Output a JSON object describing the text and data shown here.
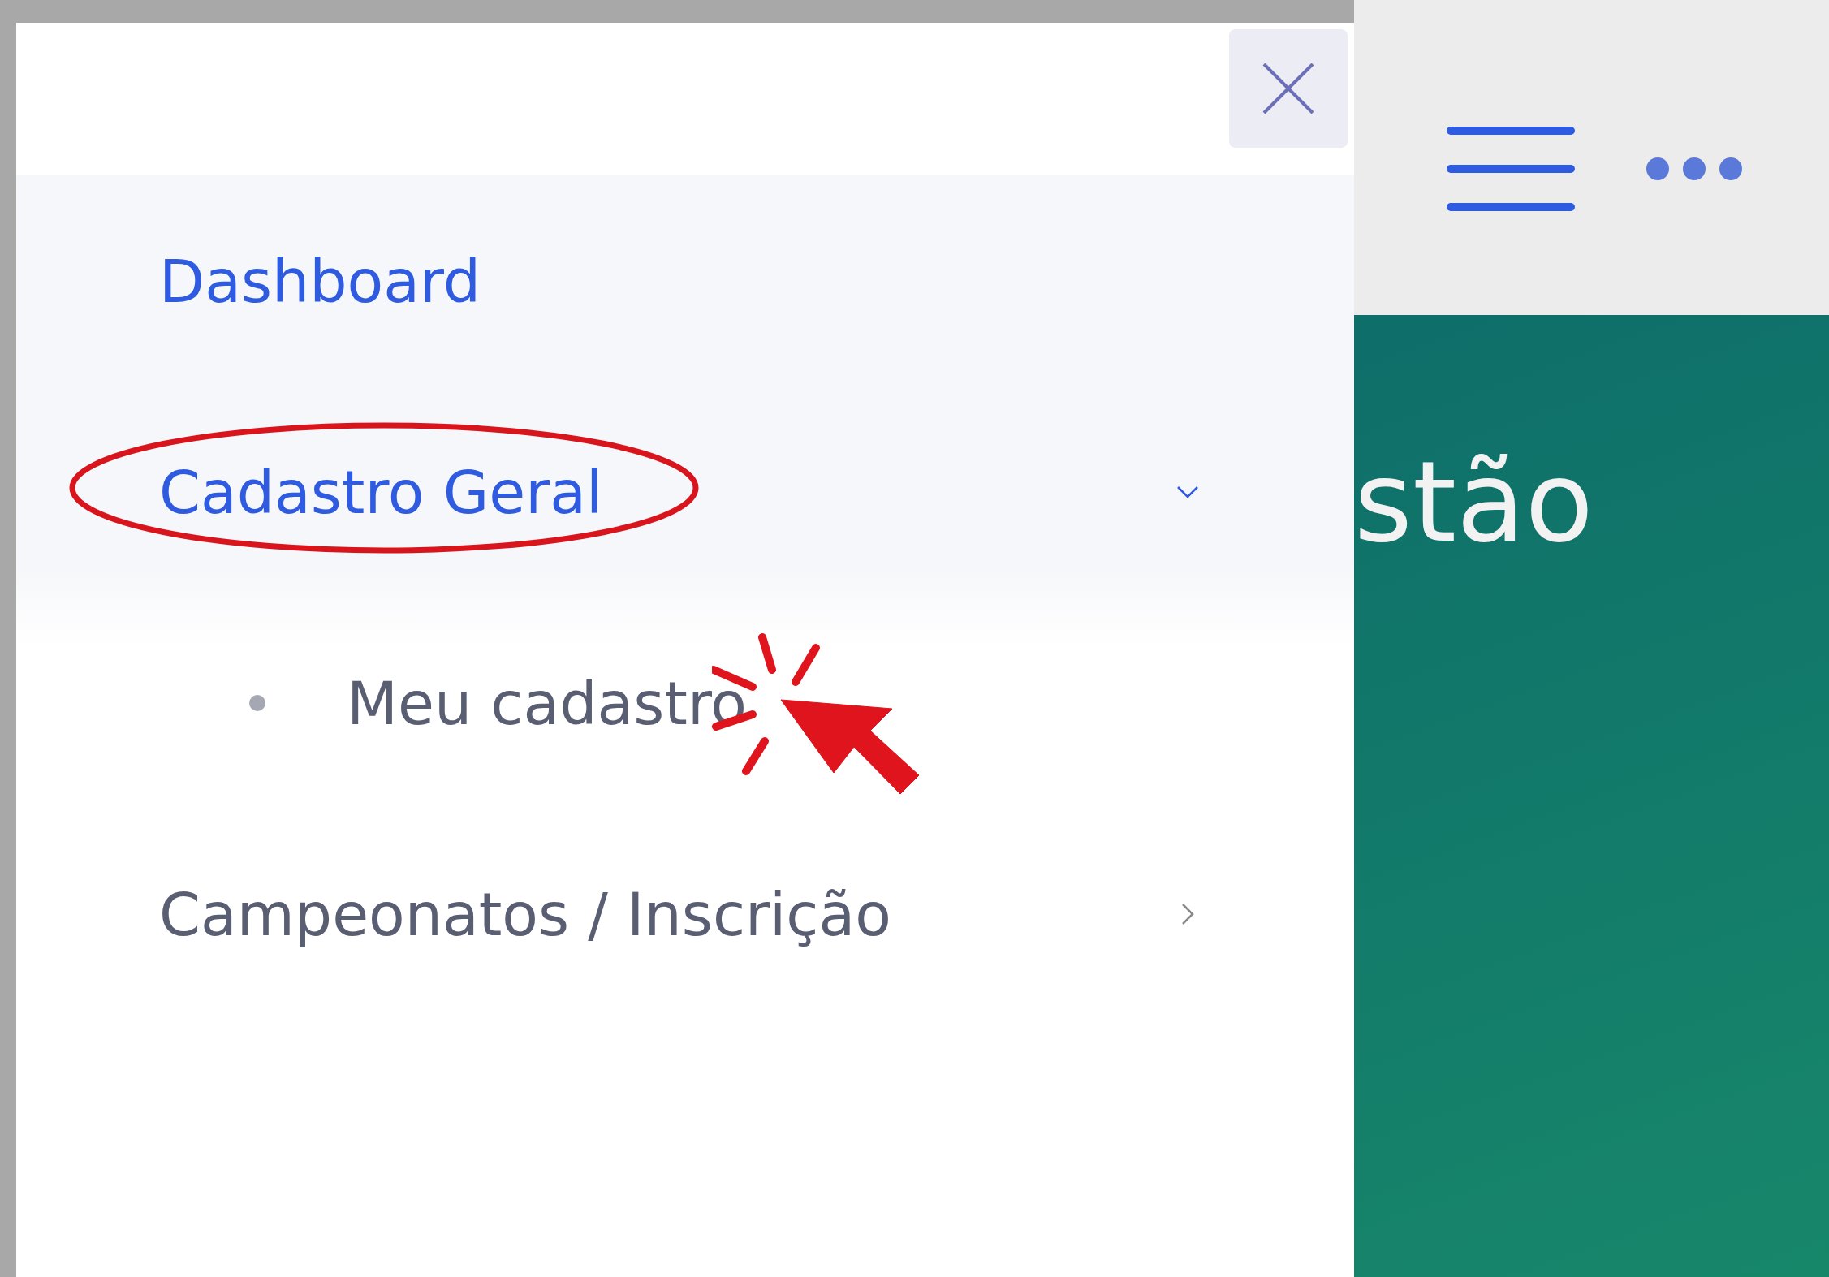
{
  "sidebar": {
    "items": [
      {
        "label": "Dashboard",
        "selected": true,
        "kind": "link"
      },
      {
        "label": "Cadastro Geral",
        "selected": true,
        "kind": "group",
        "expanded": true,
        "children": [
          {
            "label": "Meu cadastro",
            "selected": false
          }
        ]
      },
      {
        "label": "Campeonatos / Inscrição",
        "selected": false,
        "kind": "group",
        "expanded": false
      }
    ]
  },
  "main": {
    "heading": "stão"
  }
}
